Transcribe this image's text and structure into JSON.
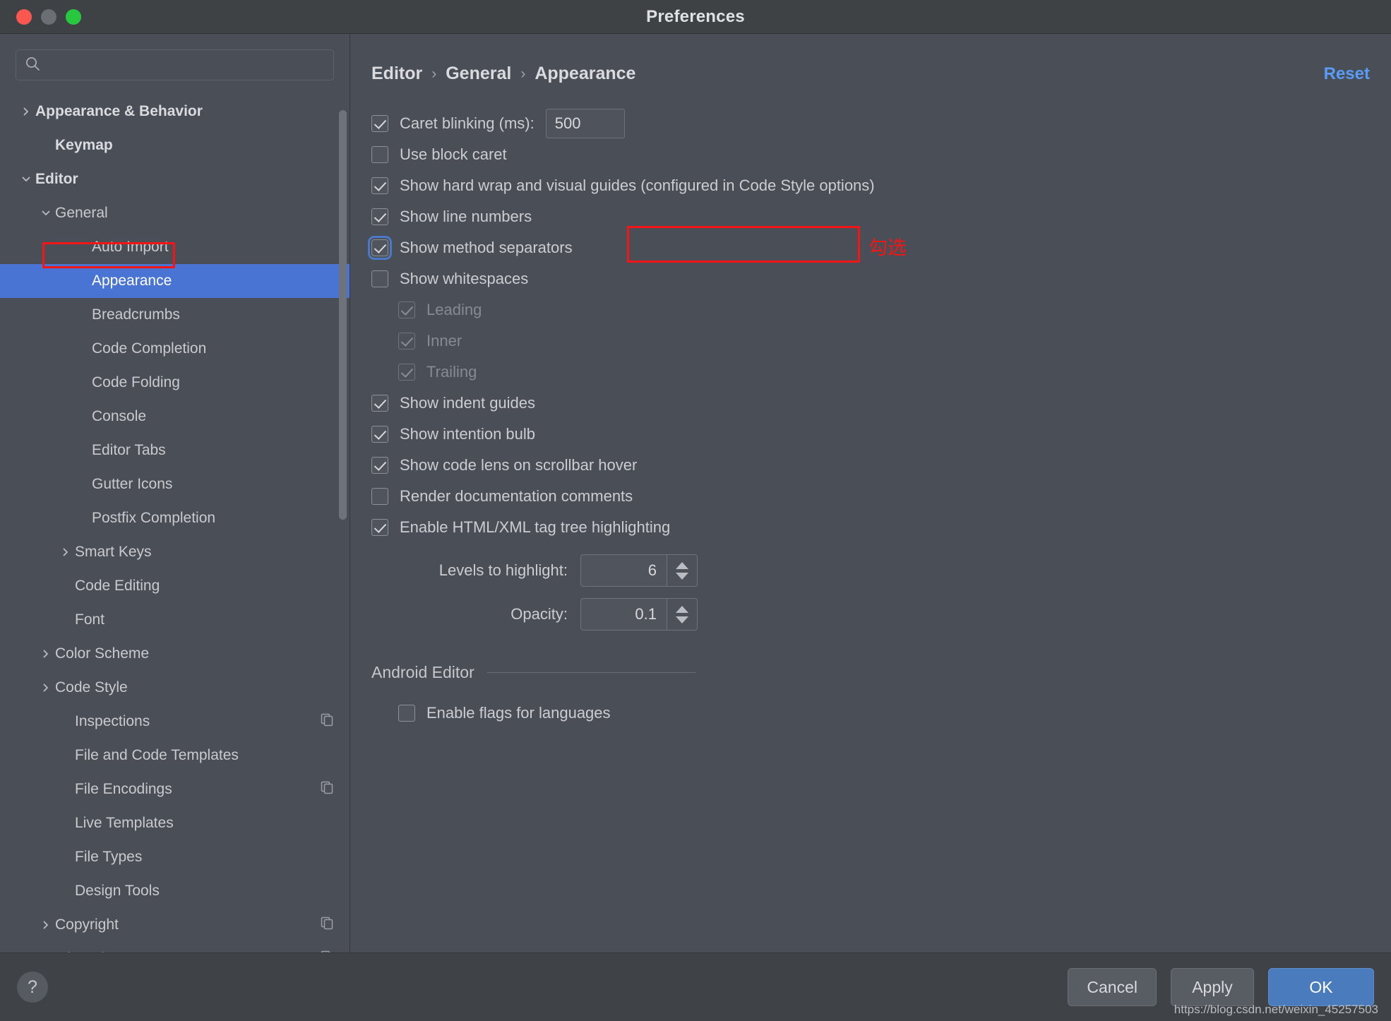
{
  "window": {
    "title": "Preferences",
    "traffic_lights": [
      "close",
      "minimize",
      "zoom"
    ]
  },
  "sidebar": {
    "search": {
      "placeholder": "",
      "value": "",
      "icon": "search-icon"
    },
    "items": [
      {
        "label": "Appearance & Behavior",
        "indent": 0,
        "arrow": "right",
        "bold": true,
        "selected": false,
        "copy": false
      },
      {
        "label": "Keymap",
        "indent": 1,
        "arrow": "none",
        "bold": true,
        "selected": false,
        "copy": false
      },
      {
        "label": "Editor",
        "indent": 0,
        "arrow": "down",
        "bold": true,
        "selected": false,
        "copy": false
      },
      {
        "label": "General",
        "indent": 1,
        "arrow": "down",
        "bold": false,
        "selected": false,
        "copy": false
      },
      {
        "label": "Auto Import",
        "indent": 3,
        "arrow": "none",
        "bold": false,
        "selected": false,
        "copy": false
      },
      {
        "label": "Appearance",
        "indent": 3,
        "arrow": "none",
        "bold": false,
        "selected": true,
        "copy": false
      },
      {
        "label": "Breadcrumbs",
        "indent": 3,
        "arrow": "none",
        "bold": false,
        "selected": false,
        "copy": false
      },
      {
        "label": "Code Completion",
        "indent": 3,
        "arrow": "none",
        "bold": false,
        "selected": false,
        "copy": false
      },
      {
        "label": "Code Folding",
        "indent": 3,
        "arrow": "none",
        "bold": false,
        "selected": false,
        "copy": false
      },
      {
        "label": "Console",
        "indent": 3,
        "arrow": "none",
        "bold": false,
        "selected": false,
        "copy": false
      },
      {
        "label": "Editor Tabs",
        "indent": 3,
        "arrow": "none",
        "bold": false,
        "selected": false,
        "copy": false
      },
      {
        "label": "Gutter Icons",
        "indent": 3,
        "arrow": "none",
        "bold": false,
        "selected": false,
        "copy": false
      },
      {
        "label": "Postfix Completion",
        "indent": 3,
        "arrow": "none",
        "bold": false,
        "selected": false,
        "copy": false
      },
      {
        "label": "Smart Keys",
        "indent": 2,
        "arrow": "right",
        "bold": false,
        "selected": false,
        "copy": false
      },
      {
        "label": "Code Editing",
        "indent": 2,
        "arrow": "none",
        "bold": false,
        "selected": false,
        "copy": false
      },
      {
        "label": "Font",
        "indent": 2,
        "arrow": "none",
        "bold": false,
        "selected": false,
        "copy": false
      },
      {
        "label": "Color Scheme",
        "indent": 1,
        "arrow": "right",
        "bold": false,
        "selected": false,
        "copy": false
      },
      {
        "label": "Code Style",
        "indent": 1,
        "arrow": "right",
        "bold": false,
        "selected": false,
        "copy": false
      },
      {
        "label": "Inspections",
        "indent": 2,
        "arrow": "none",
        "bold": false,
        "selected": false,
        "copy": true
      },
      {
        "label": "File and Code Templates",
        "indent": 2,
        "arrow": "none",
        "bold": false,
        "selected": false,
        "copy": false
      },
      {
        "label": "File Encodings",
        "indent": 2,
        "arrow": "none",
        "bold": false,
        "selected": false,
        "copy": true
      },
      {
        "label": "Live Templates",
        "indent": 2,
        "arrow": "none",
        "bold": false,
        "selected": false,
        "copy": false
      },
      {
        "label": "File Types",
        "indent": 2,
        "arrow": "none",
        "bold": false,
        "selected": false,
        "copy": false
      },
      {
        "label": "Design Tools",
        "indent": 2,
        "arrow": "none",
        "bold": false,
        "selected": false,
        "copy": false
      },
      {
        "label": "Copyright",
        "indent": 1,
        "arrow": "right",
        "bold": false,
        "selected": false,
        "copy": true
      },
      {
        "label": "Inlay Hints",
        "indent": 1,
        "arrow": "right",
        "bold": false,
        "selected": false,
        "copy": true
      }
    ]
  },
  "main": {
    "breadcrumb": [
      "Editor",
      "General",
      "Appearance"
    ],
    "breadcrumb_separator": "›",
    "reset_label": "Reset",
    "caret_blinking": {
      "label": "Caret blinking (ms):",
      "checked": true,
      "value": "500"
    },
    "options": [
      {
        "label": "Use block caret",
        "checked": false,
        "indent": 0,
        "disabled": false,
        "focus": false
      },
      {
        "label": "Show hard wrap and visual guides (configured in Code Style options)",
        "checked": true,
        "indent": 0,
        "disabled": false,
        "focus": false
      },
      {
        "label": "Show line numbers",
        "checked": true,
        "indent": 0,
        "disabled": false,
        "focus": false
      },
      {
        "label": "Show method separators",
        "checked": true,
        "indent": 0,
        "disabled": false,
        "focus": true
      },
      {
        "label": "Show whitespaces",
        "checked": false,
        "indent": 0,
        "disabled": false,
        "focus": false
      },
      {
        "label": "Leading",
        "checked": true,
        "indent": 1,
        "disabled": true,
        "focus": false
      },
      {
        "label": "Inner",
        "checked": true,
        "indent": 1,
        "disabled": true,
        "focus": false
      },
      {
        "label": "Trailing",
        "checked": true,
        "indent": 1,
        "disabled": true,
        "focus": false
      },
      {
        "label": "Show indent guides",
        "checked": true,
        "indent": 0,
        "disabled": false,
        "focus": false
      },
      {
        "label": "Show intention bulb",
        "checked": true,
        "indent": 0,
        "disabled": false,
        "focus": false
      },
      {
        "label": "Show code lens on scrollbar hover",
        "checked": true,
        "indent": 0,
        "disabled": false,
        "focus": false
      },
      {
        "label": "Render documentation comments",
        "checked": false,
        "indent": 0,
        "disabled": false,
        "focus": false
      },
      {
        "label": "Enable HTML/XML tag tree highlighting",
        "checked": true,
        "indent": 0,
        "disabled": false,
        "focus": false
      }
    ],
    "spinners": [
      {
        "label": "Levels to highlight:",
        "value": "6"
      },
      {
        "label": "Opacity:",
        "value": "0.1"
      }
    ],
    "android_group": {
      "title": "Android Editor",
      "option": {
        "label": "Enable flags for languages",
        "checked": false
      }
    }
  },
  "annotations": {
    "method_note": "勾选"
  },
  "footer": {
    "help_label": "?",
    "cancel_label": "Cancel",
    "apply_label": "Apply",
    "ok_label": "OK",
    "watermark": "https://blog.csdn.net/weixin_45257503"
  },
  "colors": {
    "accent": "#4a74d4",
    "link": "#599cf5",
    "annotation": "#f41616",
    "window_bg": "#4a4e57"
  }
}
